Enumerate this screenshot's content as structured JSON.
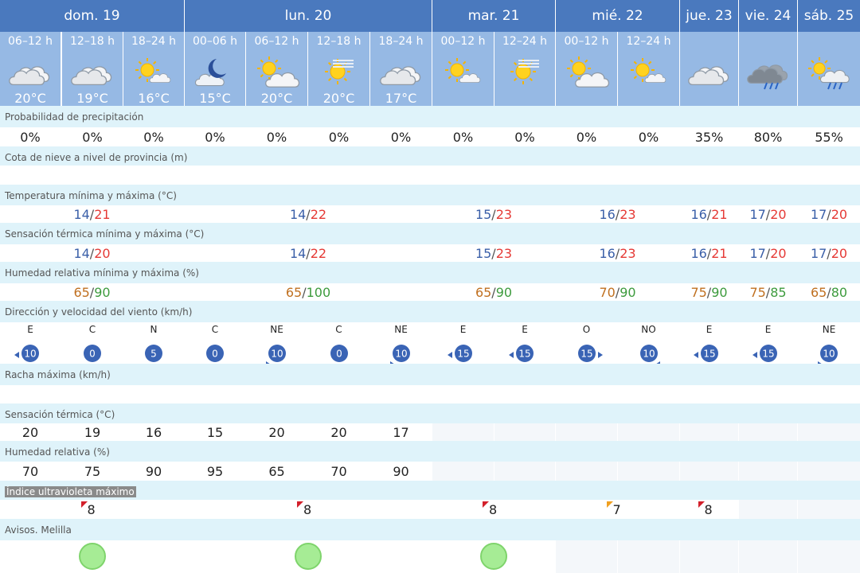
{
  "days": [
    {
      "label": "dom. 19"
    },
    {
      "label": "lun. 20"
    },
    {
      "label": "mar. 21"
    },
    {
      "label": "mié. 22"
    },
    {
      "label": "jue. 23"
    },
    {
      "label": "vie. 24"
    },
    {
      "label": "sáb. 25"
    }
  ],
  "periods": [
    {
      "label": "06–12 h",
      "icon": "cloudy-icon",
      "temp": "20°C"
    },
    {
      "label": "12–18 h",
      "icon": "cloudy-icon",
      "temp": "19°C"
    },
    {
      "label": "18–24 h",
      "icon": "sun-cloud-icon",
      "temp": "16°C"
    },
    {
      "label": "00–06 h",
      "icon": "moon-cloud-icon",
      "temp": "15°C"
    },
    {
      "label": "06–12 h",
      "icon": "sun-big-cloud-icon",
      "temp": "20°C"
    },
    {
      "label": "12–18 h",
      "icon": "sun-haze-icon",
      "temp": "20°C"
    },
    {
      "label": "18–24 h",
      "icon": "cloudy-icon",
      "temp": "17°C"
    },
    {
      "label": "00–12 h",
      "icon": "sun-cloud-icon",
      "temp": ""
    },
    {
      "label": "12–24 h",
      "icon": "sun-haze-icon",
      "temp": ""
    },
    {
      "label": "00–12 h",
      "icon": "sun-big-cloud-icon",
      "temp": ""
    },
    {
      "label": "12–24 h",
      "icon": "sun-cloud-icon",
      "temp": ""
    },
    {
      "label": "",
      "icon": "cloudy-icon",
      "temp": ""
    },
    {
      "label": "",
      "icon": "rain-cloud-icon",
      "temp": ""
    },
    {
      "label": "",
      "icon": "sun-rain-icon",
      "temp": ""
    }
  ],
  "labels": {
    "precip": "Probabilidad de precipitación",
    "snow": "Cota de nieve a nivel de provincia (m)",
    "temp": "Temperatura mínima y máxima (°C)",
    "feels": "Sensación térmica mínima y máxima (°C)",
    "humidity_range": "Humedad relativa mínima y máxima (%)",
    "wind": "Dirección y velocidad del viento (km/h)",
    "gust": "Racha máxima (km/h)",
    "feels_period": "Sensación térmica (°C)",
    "humidity_period": "Humedad relativa (%)",
    "uv": "Índice ultravioleta máximo",
    "warnings": "Avisos. Melilla"
  },
  "precip": [
    "0%",
    "0%",
    "0%",
    "0%",
    "0%",
    "0%",
    "0%",
    "0%",
    "0%",
    "0%",
    "0%",
    "35%",
    "80%",
    "55%"
  ],
  "temp_range": [
    {
      "min": "14",
      "max": "21"
    },
    {
      "min": "14",
      "max": "22"
    },
    {
      "min": "15",
      "max": "23"
    },
    {
      "min": "16",
      "max": "23"
    },
    {
      "min": "16",
      "max": "21"
    },
    {
      "min": "17",
      "max": "20"
    },
    {
      "min": "17",
      "max": "20"
    }
  ],
  "feels_range": [
    {
      "min": "14",
      "max": "20"
    },
    {
      "min": "14",
      "max": "22"
    },
    {
      "min": "15",
      "max": "23"
    },
    {
      "min": "16",
      "max": "23"
    },
    {
      "min": "16",
      "max": "21"
    },
    {
      "min": "17",
      "max": "20"
    },
    {
      "min": "17",
      "max": "20"
    }
  ],
  "humidity_range": [
    {
      "min": "65",
      "max": "90"
    },
    {
      "min": "65",
      "max": "100"
    },
    {
      "min": "65",
      "max": "90"
    },
    {
      "min": "70",
      "max": "90"
    },
    {
      "min": "75",
      "max": "90"
    },
    {
      "min": "75",
      "max": "85"
    },
    {
      "min": "65",
      "max": "80"
    }
  ],
  "wind": [
    {
      "dir": "E",
      "speed": "10",
      "arrow": "west"
    },
    {
      "dir": "C",
      "speed": "0",
      "arrow": "none"
    },
    {
      "dir": "N",
      "speed": "5",
      "arrow": "south"
    },
    {
      "dir": "C",
      "speed": "0",
      "arrow": "none"
    },
    {
      "dir": "NE",
      "speed": "10",
      "arrow": "southwest"
    },
    {
      "dir": "C",
      "speed": "0",
      "arrow": "none"
    },
    {
      "dir": "NE",
      "speed": "10",
      "arrow": "southwest"
    },
    {
      "dir": "E",
      "speed": "15",
      "arrow": "west"
    },
    {
      "dir": "E",
      "speed": "15",
      "arrow": "west"
    },
    {
      "dir": "O",
      "speed": "15",
      "arrow": "east"
    },
    {
      "dir": "NO",
      "speed": "10",
      "arrow": "southeast"
    },
    {
      "dir": "E",
      "speed": "15",
      "arrow": "west"
    },
    {
      "dir": "E",
      "speed": "15",
      "arrow": "west"
    },
    {
      "dir": "NE",
      "speed": "10",
      "arrow": "southwest"
    }
  ],
  "feels_period": [
    "20",
    "19",
    "16",
    "15",
    "20",
    "20",
    "17"
  ],
  "humidity_period": [
    "70",
    "75",
    "90",
    "95",
    "65",
    "70",
    "90"
  ],
  "uv": [
    {
      "value": "8",
      "color": "#d3202b"
    },
    {
      "value": "8",
      "color": "#d3202b"
    },
    {
      "value": "8",
      "color": "#d3202b"
    },
    {
      "value": "7",
      "color": "#f0a020"
    },
    {
      "value": "8",
      "color": "#d3202b"
    }
  ],
  "warnings": [
    {
      "level": "verde",
      "color": "#a6ec95"
    },
    {
      "level": "verde",
      "color": "#a6ec95"
    },
    {
      "level": "verde",
      "color": "#a6ec95"
    }
  ]
}
